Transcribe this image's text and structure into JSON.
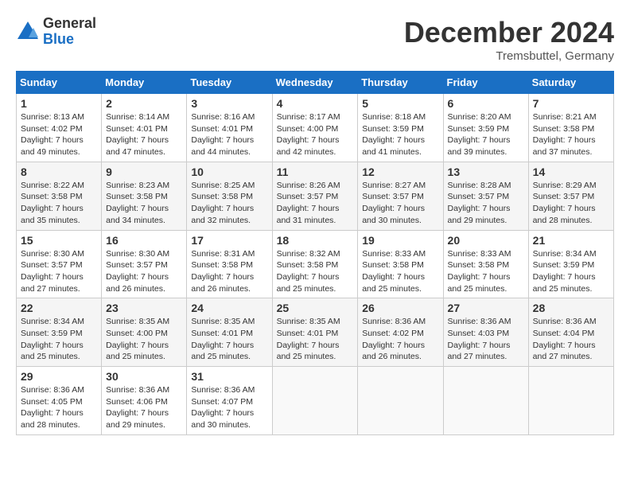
{
  "logo": {
    "general": "General",
    "blue": "Blue"
  },
  "title": "December 2024",
  "location": "Tremsbuttel, Germany",
  "days_header": [
    "Sunday",
    "Monday",
    "Tuesday",
    "Wednesday",
    "Thursday",
    "Friday",
    "Saturday"
  ],
  "weeks": [
    [
      {
        "day": "1",
        "sunrise": "8:13 AM",
        "sunset": "4:02 PM",
        "daylight": "7 hours and 49 minutes."
      },
      {
        "day": "2",
        "sunrise": "8:14 AM",
        "sunset": "4:01 PM",
        "daylight": "7 hours and 47 minutes."
      },
      {
        "day": "3",
        "sunrise": "8:16 AM",
        "sunset": "4:01 PM",
        "daylight": "7 hours and 44 minutes."
      },
      {
        "day": "4",
        "sunrise": "8:17 AM",
        "sunset": "4:00 PM",
        "daylight": "7 hours and 42 minutes."
      },
      {
        "day": "5",
        "sunrise": "8:18 AM",
        "sunset": "3:59 PM",
        "daylight": "7 hours and 41 minutes."
      },
      {
        "day": "6",
        "sunrise": "8:20 AM",
        "sunset": "3:59 PM",
        "daylight": "7 hours and 39 minutes."
      },
      {
        "day": "7",
        "sunrise": "8:21 AM",
        "sunset": "3:58 PM",
        "daylight": "7 hours and 37 minutes."
      }
    ],
    [
      {
        "day": "8",
        "sunrise": "8:22 AM",
        "sunset": "3:58 PM",
        "daylight": "7 hours and 35 minutes."
      },
      {
        "day": "9",
        "sunrise": "8:23 AM",
        "sunset": "3:58 PM",
        "daylight": "7 hours and 34 minutes."
      },
      {
        "day": "10",
        "sunrise": "8:25 AM",
        "sunset": "3:58 PM",
        "daylight": "7 hours and 32 minutes."
      },
      {
        "day": "11",
        "sunrise": "8:26 AM",
        "sunset": "3:57 PM",
        "daylight": "7 hours and 31 minutes."
      },
      {
        "day": "12",
        "sunrise": "8:27 AM",
        "sunset": "3:57 PM",
        "daylight": "7 hours and 30 minutes."
      },
      {
        "day": "13",
        "sunrise": "8:28 AM",
        "sunset": "3:57 PM",
        "daylight": "7 hours and 29 minutes."
      },
      {
        "day": "14",
        "sunrise": "8:29 AM",
        "sunset": "3:57 PM",
        "daylight": "7 hours and 28 minutes."
      }
    ],
    [
      {
        "day": "15",
        "sunrise": "8:30 AM",
        "sunset": "3:57 PM",
        "daylight": "7 hours and 27 minutes."
      },
      {
        "day": "16",
        "sunrise": "8:30 AM",
        "sunset": "3:57 PM",
        "daylight": "7 hours and 26 minutes."
      },
      {
        "day": "17",
        "sunrise": "8:31 AM",
        "sunset": "3:58 PM",
        "daylight": "7 hours and 26 minutes."
      },
      {
        "day": "18",
        "sunrise": "8:32 AM",
        "sunset": "3:58 PM",
        "daylight": "7 hours and 25 minutes."
      },
      {
        "day": "19",
        "sunrise": "8:33 AM",
        "sunset": "3:58 PM",
        "daylight": "7 hours and 25 minutes."
      },
      {
        "day": "20",
        "sunrise": "8:33 AM",
        "sunset": "3:58 PM",
        "daylight": "7 hours and 25 minutes."
      },
      {
        "day": "21",
        "sunrise": "8:34 AM",
        "sunset": "3:59 PM",
        "daylight": "7 hours and 25 minutes."
      }
    ],
    [
      {
        "day": "22",
        "sunrise": "8:34 AM",
        "sunset": "3:59 PM",
        "daylight": "7 hours and 25 minutes."
      },
      {
        "day": "23",
        "sunrise": "8:35 AM",
        "sunset": "4:00 PM",
        "daylight": "7 hours and 25 minutes."
      },
      {
        "day": "24",
        "sunrise": "8:35 AM",
        "sunset": "4:01 PM",
        "daylight": "7 hours and 25 minutes."
      },
      {
        "day": "25",
        "sunrise": "8:35 AM",
        "sunset": "4:01 PM",
        "daylight": "7 hours and 25 minutes."
      },
      {
        "day": "26",
        "sunrise": "8:36 AM",
        "sunset": "4:02 PM",
        "daylight": "7 hours and 26 minutes."
      },
      {
        "day": "27",
        "sunrise": "8:36 AM",
        "sunset": "4:03 PM",
        "daylight": "7 hours and 27 minutes."
      },
      {
        "day": "28",
        "sunrise": "8:36 AM",
        "sunset": "4:04 PM",
        "daylight": "7 hours and 27 minutes."
      }
    ],
    [
      {
        "day": "29",
        "sunrise": "8:36 AM",
        "sunset": "4:05 PM",
        "daylight": "7 hours and 28 minutes."
      },
      {
        "day": "30",
        "sunrise": "8:36 AM",
        "sunset": "4:06 PM",
        "daylight": "7 hours and 29 minutes."
      },
      {
        "day": "31",
        "sunrise": "8:36 AM",
        "sunset": "4:07 PM",
        "daylight": "7 hours and 30 minutes."
      },
      null,
      null,
      null,
      null
    ]
  ],
  "labels": {
    "sunrise": "Sunrise:",
    "sunset": "Sunset:",
    "daylight": "Daylight:"
  }
}
